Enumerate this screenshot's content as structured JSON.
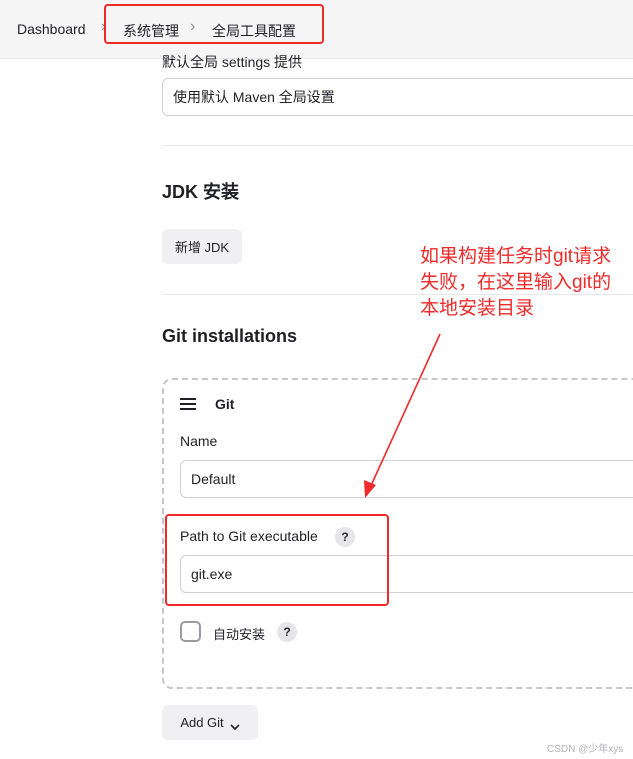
{
  "breadcrumb": {
    "items": [
      "Dashboard",
      "系统管理",
      "全局工具配置"
    ],
    "separator": "›"
  },
  "maven_settings": {
    "label": "默认全局 settings 提供",
    "value": "使用默认 Maven 全局设置"
  },
  "jdk": {
    "title": "JDK 安装",
    "add_button": "新增 JDK"
  },
  "git": {
    "title": "Git installations",
    "card": {
      "header": "Git",
      "name_label": "Name",
      "name_value": "Default",
      "path_label": "Path to Git executable",
      "path_value": "git.exe",
      "auto_install_label": "自动安装",
      "auto_install_checked": false,
      "help_glyph": "?"
    },
    "add_button": "Add Git"
  },
  "annotation": {
    "text": "如果构建任务时git请求失败，在这里输入git的本地安装目录",
    "color": "#ee2a2a"
  },
  "watermark": "CSDN @少年xys",
  "icons": {
    "drag_handle": "hamburger-icon",
    "dropdown": "chevron-down-icon",
    "help": "help-icon"
  }
}
